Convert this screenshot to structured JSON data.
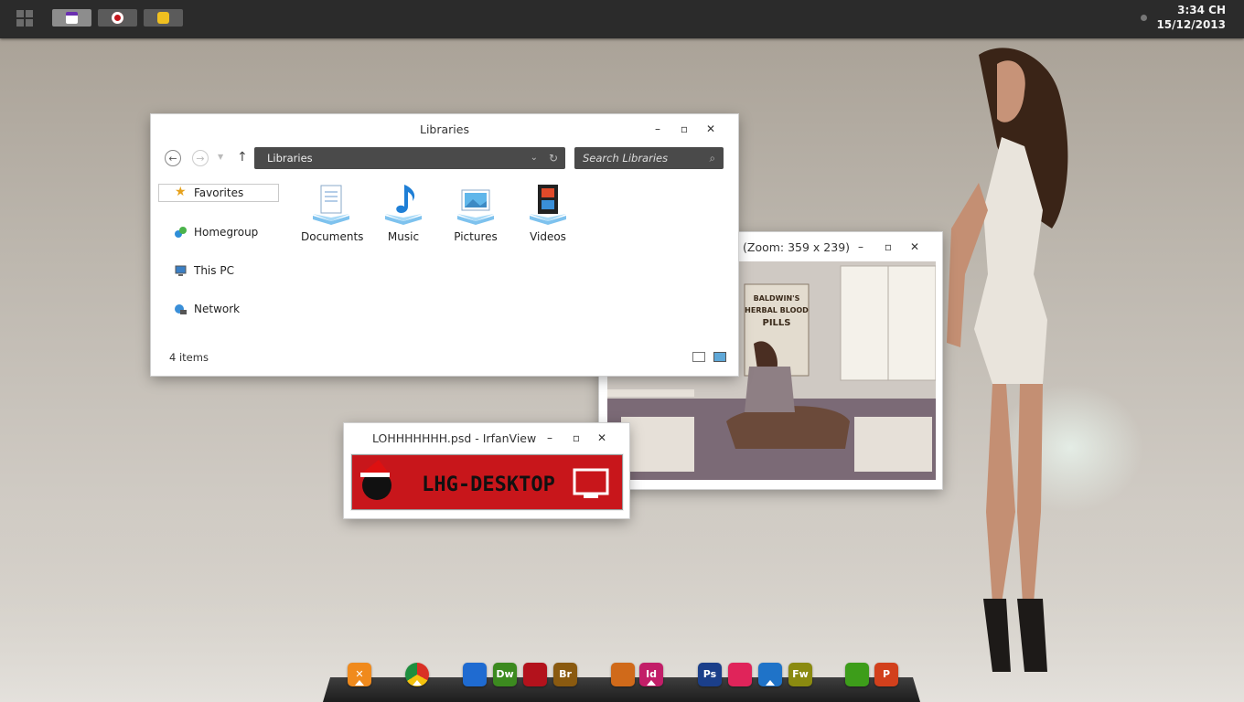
{
  "taskbar": {
    "buttons": [
      {
        "name": "explorer-task",
        "color": "#6a2fb0",
        "active": true
      },
      {
        "name": "target-task",
        "color": "#c4151c",
        "active": false
      },
      {
        "name": "smile-task",
        "color": "#f0c020",
        "active": false
      }
    ],
    "clock": {
      "time": "3:34 CH",
      "date": "15/12/2013"
    }
  },
  "explorer": {
    "title": "Libraries",
    "address": "Libraries",
    "search_placeholder": "Search Libraries",
    "nav": {
      "favorites": "Favorites",
      "homegroup": "Homegroup",
      "this_pc": "This PC",
      "network": "Network"
    },
    "libraries": [
      {
        "label": "Documents",
        "icon": "documents-icon"
      },
      {
        "label": "Music",
        "icon": "music-icon"
      },
      {
        "label": "Pictures",
        "icon": "pictures-icon"
      },
      {
        "label": "Videos",
        "icon": "videos-icon"
      }
    ],
    "status": "4 items"
  },
  "viewer": {
    "title": "(Zoom: 359 x 239)",
    "poster": [
      "BALDWIN'S",
      "HERBAL BLOOD",
      "PILLS"
    ]
  },
  "irfan": {
    "title": "LOHHHHHHH.psd - IrfanView",
    "banner_text": "LHG-DESKTOP"
  },
  "dock": {
    "apps": [
      {
        "name": "tools",
        "label": "✕",
        "color": "#f08a1c"
      },
      {
        "name": "chrome",
        "label": "",
        "color": "#e8e8e8"
      },
      {
        "name": "firefox",
        "label": "",
        "color": "#1f6bd1"
      },
      {
        "name": "dreamweaver",
        "label": "Dw",
        "color": "#3c8a1f"
      },
      {
        "name": "flash",
        "label": "",
        "color": "#b3121c"
      },
      {
        "name": "bridge",
        "label": "Br",
        "color": "#8a5a10"
      },
      {
        "name": "illustrator-like",
        "label": "",
        "color": "#d06a1a"
      },
      {
        "name": "indesign",
        "label": "Id",
        "color": "#c21e68"
      },
      {
        "name": "photoshop",
        "label": "Ps",
        "color": "#1b3f8a"
      },
      {
        "name": "media",
        "label": "",
        "color": "#e0245a"
      },
      {
        "name": "maxthon",
        "label": "",
        "color": "#1f73c8"
      },
      {
        "name": "fireworks",
        "label": "Fw",
        "color": "#8a8a10"
      },
      {
        "name": "utorrent",
        "label": "",
        "color": "#3d9d1a"
      },
      {
        "name": "powerpoint",
        "label": "P",
        "color": "#d2401c"
      }
    ]
  }
}
